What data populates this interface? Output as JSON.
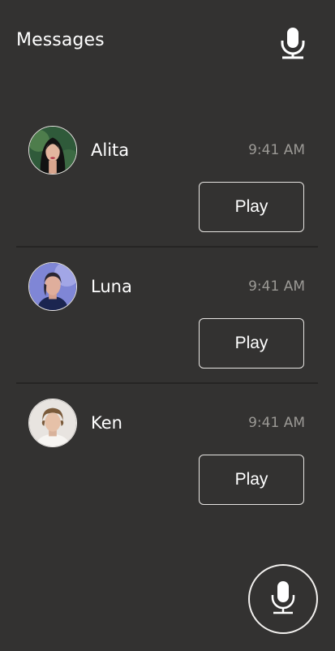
{
  "header": {
    "title": "Messages",
    "mic_icon": "microphone-icon"
  },
  "messages": [
    {
      "name": "Alita",
      "time": "9:41 AM",
      "play_label": "Play",
      "avatar": "avatar-photo"
    },
    {
      "name": "Luna",
      "time": "9:41 AM",
      "play_label": "Play",
      "avatar": "avatar-photo"
    },
    {
      "name": "Ken",
      "time": "9:41 AM",
      "play_label": "Play",
      "avatar": "avatar-photo"
    }
  ],
  "fab": {
    "icon": "microphone-icon"
  },
  "colors": {
    "background": "#333231",
    "text": "#ffffff",
    "muted": "#9b9995",
    "divider": "#252423"
  }
}
